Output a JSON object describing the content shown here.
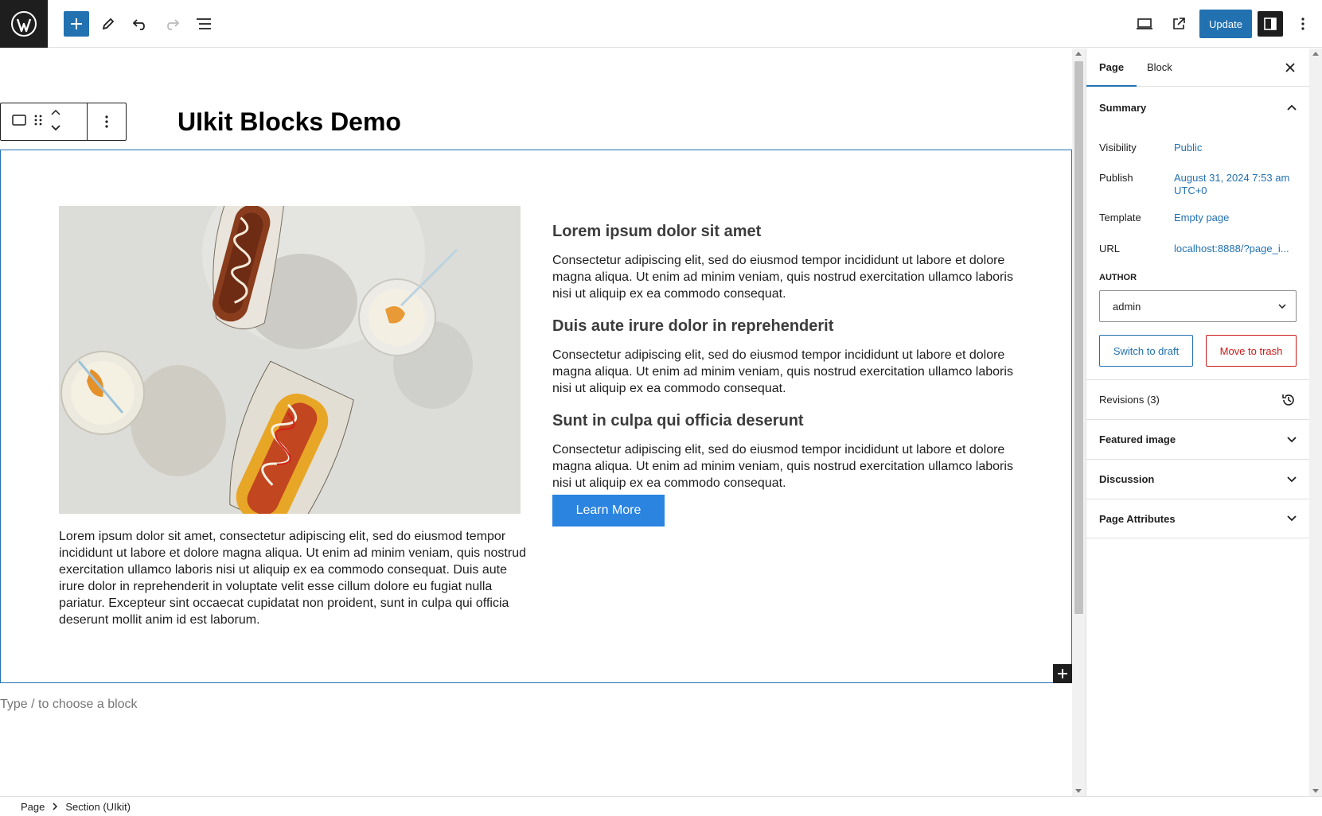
{
  "toolbar": {
    "update_label": "Update",
    "icons": [
      "wordpress-icon",
      "plus-icon",
      "pencil-icon",
      "undo-icon",
      "redo-icon",
      "list-view-icon",
      "desktop-preview-icon",
      "external-link-icon",
      "sidebar-toggle-icon",
      "more-vertical-icon"
    ]
  },
  "editor": {
    "title": "UIkit Blocks Demo",
    "left_paragraph": "Lorem ipsum dolor sit amet, consectetur adipiscing elit, sed do eiusmod tempor incididunt ut labore et dolore magna aliqua. Ut enim ad minim veniam, quis nostrud exercitation ullamco laboris nisi ut aliquip ex ea commodo consequat. Duis aute irure dolor in reprehenderit in voluptate velit esse cillum dolore eu fugiat nulla pariatur. Excepteur sint occaecat cupidatat non proident, sunt in culpa qui officia deserunt mollit anim id est laborum.",
    "items": [
      {
        "heading": "Lorem ipsum dolor sit amet",
        "text": "Consectetur adipiscing elit, sed do eiusmod tempor incididunt ut labore et dolore magna aliqua. Ut enim ad minim veniam, quis nostrud exercitation ullamco laboris nisi ut aliquip ex ea commodo consequat."
      },
      {
        "heading": "Duis aute irure dolor in reprehenderit",
        "text": "Consectetur adipiscing elit, sed do eiusmod tempor incididunt ut labore et dolore magna aliqua. Ut enim ad minim veniam, quis nostrud exercitation ullamco laboris nisi ut aliquip ex ea commodo consequat."
      },
      {
        "heading": "Sunt in culpa qui officia deserunt",
        "text": "Consectetur adipiscing elit, sed do eiusmod tempor incididunt ut labore et dolore magna aliqua. Ut enim ad minim veniam, quis nostrud exercitation ullamco laboris nisi ut aliquip ex ea commodo consequat."
      }
    ],
    "button_label": "Learn More",
    "placeholder": "Type / to choose a block"
  },
  "sidebar": {
    "tab_page": "Page",
    "tab_block": "Block",
    "summary_title": "Summary",
    "visibility_label": "Visibility",
    "visibility_value": "Public",
    "publish_label": "Publish",
    "publish_value_line1": "August 31, 2024 7:53 am",
    "publish_value_line2": "UTC+0",
    "template_label": "Template",
    "template_value": "Empty page",
    "url_label": "URL",
    "url_value": "localhost:8888/?page_i...",
    "author_label": "AUTHOR",
    "author_value": "admin",
    "switch_draft": "Switch to draft",
    "move_trash": "Move to trash",
    "revisions": "Revisions (3)",
    "featured_image": "Featured image",
    "discussion": "Discussion",
    "page_attributes": "Page Attributes"
  },
  "breadcrumb": {
    "items": [
      "Page",
      "Section (UIkit)"
    ]
  },
  "colors": {
    "accent": "#2271b1",
    "button": "#2a84e0",
    "danger": "#cc1818",
    "dark": "#1e1e1e"
  }
}
